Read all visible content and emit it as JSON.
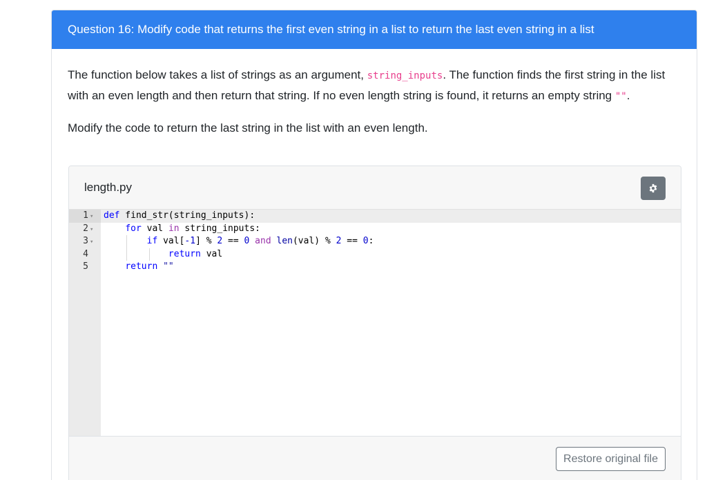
{
  "question": {
    "title": "Question 16: Modify code that returns the first even string in a list to return the last even string in a list",
    "prompt_part1": "The function below takes a list of strings as an argument, ",
    "prompt_code": "string_inputs",
    "prompt_part2": ". The function finds the first string in the list with an even length and then return that string. If no even length string is found, it returns an empty string ",
    "prompt_empty_str": "\"\"",
    "prompt_part3": ".",
    "instruction": "Modify the code to return the last string in the list with an even length."
  },
  "editor": {
    "filename": "length.py",
    "settings_icon": "gear-icon",
    "line_numbers": [
      "1",
      "2",
      "3",
      "4",
      "5"
    ],
    "code": {
      "l1_kw": "def",
      "l1_rest": " find_str(string_inputs):",
      "l2_kw": "for",
      "l2_a": " val ",
      "l2_in": "in",
      "l2_b": " string_inputs:",
      "l3_kw": "if",
      "l3_a": " val[",
      "l3_n1": "-1",
      "l3_b": "] % ",
      "l3_n2": "2",
      "l3_c": " == ",
      "l3_n3": "0",
      "l3_and": " and",
      "l3_len": " len",
      "l3_d": "(val) % ",
      "l3_n4": "2",
      "l3_e": " == ",
      "l3_n5": "0",
      "l3_f": ":",
      "l4_kw": "return",
      "l4_rest": " val",
      "l5_kw": "return",
      "l5_str": " \"\""
    },
    "restore_label": "Restore original file"
  }
}
